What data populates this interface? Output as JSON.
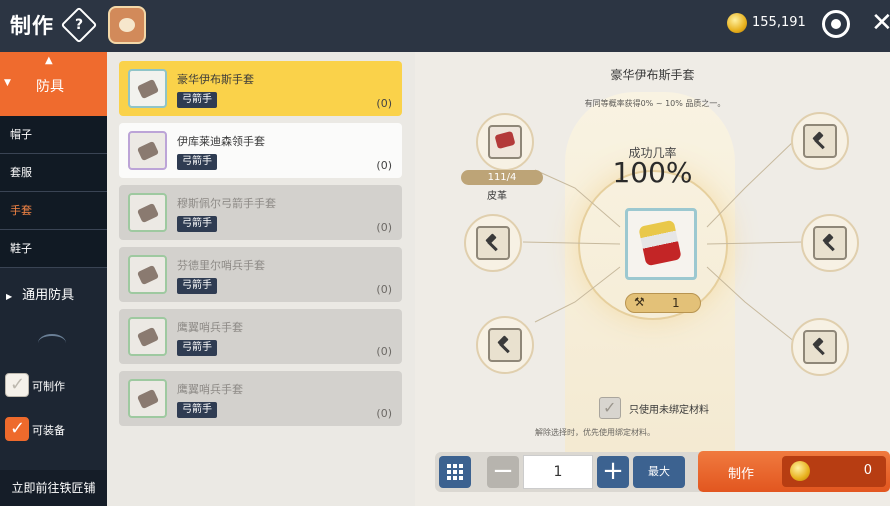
{
  "header": {
    "title": "制作",
    "help_icon": "?",
    "gold": "155,191"
  },
  "sidebar": {
    "category": "防具",
    "sub_items": [
      {
        "label": "帽子",
        "active": false
      },
      {
        "label": "套服",
        "active": false
      },
      {
        "label": "手套",
        "active": true
      },
      {
        "label": "鞋子",
        "active": false
      }
    ],
    "general_category": "通用防具",
    "filters": [
      {
        "label": "可制作",
        "checked": false
      },
      {
        "label": "可装备",
        "checked": true
      }
    ],
    "goto_label": "立即前往铁匠铺"
  },
  "items": [
    {
      "name": "豪华伊布斯手套",
      "tag": "弓箭手",
      "count": "(0)",
      "state": "selected"
    },
    {
      "name": "伊库莱迪森领手套",
      "tag": "弓箭手",
      "count": "(0)",
      "state": "available"
    },
    {
      "name": "穆斯佩尔弓箭手手套",
      "tag": "弓箭手",
      "count": "(0)",
      "state": "unavailable"
    },
    {
      "name": "芬德里尔哨兵手套",
      "tag": "弓箭手",
      "count": "(0)",
      "state": "unavailable"
    },
    {
      "name": "鹰翼哨兵手套",
      "tag": "弓箭手",
      "count": "(0)",
      "state": "unavailable"
    },
    {
      "name": "鹰翼哨兵手套",
      "tag": "弓箭手",
      "count": "(0)",
      "state": "unavailable"
    }
  ],
  "detail": {
    "title": "豪华伊布斯手套",
    "note": "有同等概率获得0% ~ 10% 品质之一。",
    "rate_label": "成功几率",
    "rate": "100%",
    "material": {
      "count": "111/4",
      "name": "皮革"
    },
    "product_qty": "1",
    "bind_label": "只使用未绑定材料",
    "bind_note": "解除选择时，优先使用绑定材料。",
    "quantity": "1",
    "max_label": "最大",
    "make_label": "制作",
    "cost": "0"
  }
}
